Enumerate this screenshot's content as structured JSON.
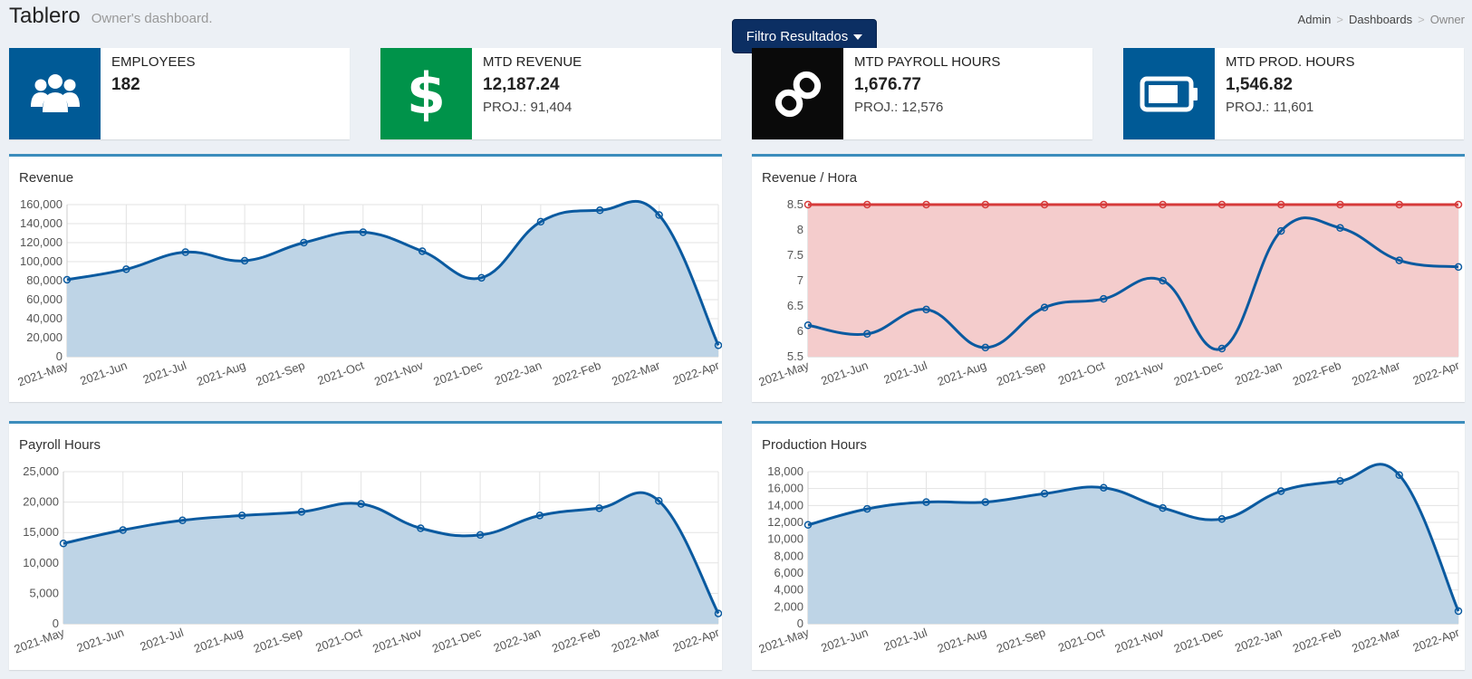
{
  "header": {
    "title": "Tablero",
    "subtitle": "Owner's dashboard."
  },
  "filter_button": {
    "label": "Filtro Resultados"
  },
  "breadcrumb": [
    "Admin",
    "Dashboards",
    "Owner"
  ],
  "info_boxes": [
    {
      "icon": "users-icon",
      "color": "#005a96",
      "label": "EMPLOYEES",
      "number": "182",
      "proj": ""
    },
    {
      "icon": "dollar-icon",
      "color": "#00934a",
      "label": "MTD REVENUE",
      "number": "12,187.24",
      "proj": "PROJ.: 91,404"
    },
    {
      "icon": "chain-link-icon",
      "color": "#0a0a0a",
      "label": "MTD PAYROLL HOURS",
      "number": "1,676.77",
      "proj": "PROJ.: 12,576"
    },
    {
      "icon": "battery-icon",
      "color": "#005a96",
      "label": "MTD PROD. HOURS",
      "number": "1,546.82",
      "proj": "PROJ.: 11,601"
    }
  ],
  "chart_data": [
    {
      "type": "area",
      "title": "Revenue",
      "x": [
        "2021-May",
        "2021-Jun",
        "2021-Jul",
        "2021-Aug",
        "2021-Sep",
        "2021-Oct",
        "2021-Nov",
        "2021-Dec",
        "2022-Jan",
        "2022-Feb",
        "2022-Mar",
        "2022-Apr"
      ],
      "series": [
        {
          "values": [
            81000,
            92000,
            110000,
            101000,
            120000,
            131000,
            111000,
            83000,
            142000,
            154000,
            149000,
            12000
          ],
          "color": "#0a5aa0",
          "fill": "#bed4e6"
        }
      ],
      "ylim": [
        0,
        160000
      ],
      "yticks": [
        "0",
        "20,000",
        "40,000",
        "60,000",
        "80,000",
        "100,000",
        "120,000",
        "140,000",
        "160,000"
      ],
      "grid": true
    },
    {
      "type": "area",
      "title": "Revenue / Hora",
      "x": [
        "2021-May",
        "2021-Jun",
        "2021-Jul",
        "2021-Aug",
        "2021-Sep",
        "2021-Oct",
        "2021-Nov",
        "2021-Dec",
        "2022-Jan",
        "2022-Feb",
        "2022-Mar",
        "2022-Apr"
      ],
      "series": [
        {
          "values": [
            8.5,
            8.5,
            8.5,
            8.5,
            8.5,
            8.5,
            8.5,
            8.5,
            8.5,
            8.5,
            8.5,
            8.5
          ],
          "color": "#d63a3a",
          "fill": "#f4cccc"
        },
        {
          "values": [
            6.12,
            5.95,
            6.43,
            5.68,
            6.47,
            6.64,
            7.0,
            5.66,
            7.98,
            8.04,
            7.4,
            7.27
          ],
          "color": "#0a5aa0",
          "fill": "none"
        }
      ],
      "ylim": [
        5.5,
        8.5
      ],
      "yticks": [
        "5.5",
        "6",
        "6.5",
        "7",
        "7.5",
        "8",
        "8.5"
      ],
      "grid": true
    },
    {
      "type": "area",
      "title": "Payroll Hours",
      "x": [
        "2021-May",
        "2021-Jun",
        "2021-Jul",
        "2021-Aug",
        "2021-Sep",
        "2021-Oct",
        "2021-Nov",
        "2021-Dec",
        "2022-Jan",
        "2022-Feb",
        "2022-Mar",
        "2022-Apr"
      ],
      "series": [
        {
          "values": [
            13200,
            15400,
            17000,
            17800,
            18400,
            19700,
            15700,
            14600,
            17800,
            19000,
            20200,
            1700
          ],
          "color": "#0a5aa0",
          "fill": "#bed4e6"
        }
      ],
      "ylim": [
        0,
        25000
      ],
      "yticks": [
        "0",
        "5,000",
        "10,000",
        "15,000",
        "20,000",
        "25,000"
      ],
      "grid": true
    },
    {
      "type": "area",
      "title": "Production Hours",
      "x": [
        "2021-May",
        "2021-Jun",
        "2021-Jul",
        "2021-Aug",
        "2021-Sep",
        "2021-Oct",
        "2021-Nov",
        "2021-Dec",
        "2022-Jan",
        "2022-Feb",
        "2022-Mar",
        "2022-Apr"
      ],
      "series": [
        {
          "values": [
            11700,
            13600,
            14400,
            14400,
            15400,
            16100,
            13700,
            12400,
            15700,
            16900,
            17600,
            1500
          ],
          "color": "#0a5aa0",
          "fill": "#bed4e6"
        }
      ],
      "ylim": [
        0,
        18000
      ],
      "yticks": [
        "0",
        "2,000",
        "4,000",
        "6,000",
        "8,000",
        "10,000",
        "12,000",
        "14,000",
        "16,000",
        "18,000"
      ],
      "grid": true
    }
  ]
}
